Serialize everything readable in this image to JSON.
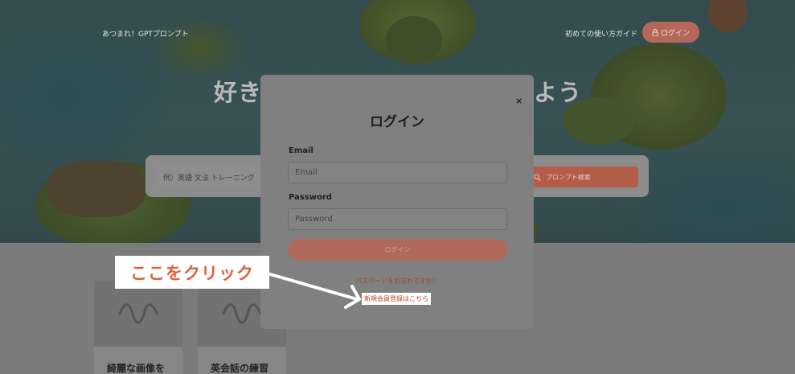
{
  "header": {
    "brand": "あつまれ！GPTプロンプト",
    "guide_link": "初めての使い方ガイド",
    "login_button": "ログイン"
  },
  "hero": {
    "title_left": "好き",
    "title_right": "よう",
    "search_placeholder": "例）英語 文法 トレーニング",
    "search_button": "プロンプト検索"
  },
  "cards": [
    {
      "label": "綺麗な画像を"
    },
    {
      "label": "英会話の練習"
    }
  ],
  "modal": {
    "close": "×",
    "title": "ログイン",
    "email_label": "Email",
    "email_placeholder": "Email",
    "password_label": "Password",
    "password_placeholder": "Password",
    "submit": "ログイン",
    "forgot_password": "パスワードをお忘れですか？",
    "register": "新規会員登録はこちら"
  },
  "annotation": {
    "callout": "ここをクリック",
    "color": "#e2613b"
  },
  "colors": {
    "accent": "#c0432a",
    "overlay": "#808080"
  }
}
